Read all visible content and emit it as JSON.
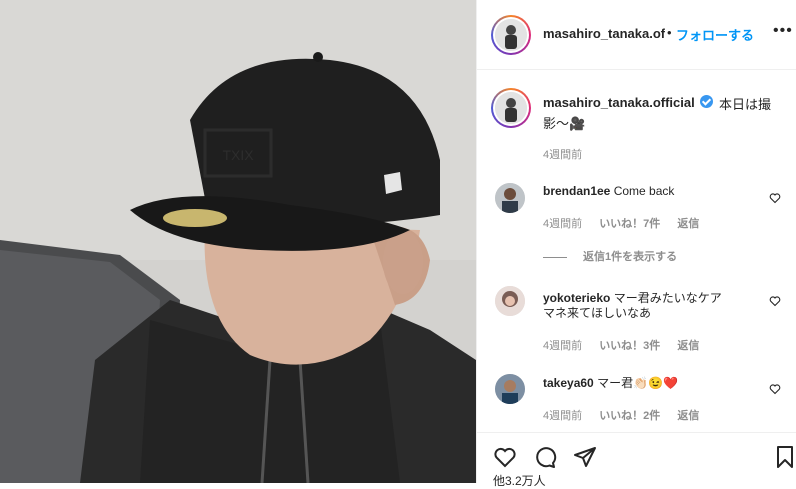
{
  "post": {
    "username": "masahiro_tanaka.official",
    "username_truncated": "masahiro_tanaka.of",
    "dot": "•",
    "follow_label": "フォローする",
    "more_label": "•••",
    "caption_text_line1": "本日は撮",
    "caption_text_line2": "影〜🎥",
    "caption_time": "4週間前"
  },
  "comments": [
    {
      "user": "brendan1ee",
      "text": "Come back",
      "time": "4週間前",
      "likes": "いいね！7件",
      "reply": "返信",
      "view_replies": "返信1件を表示する"
    },
    {
      "user": "yokoterieko",
      "text_line1": "マー君みたいなケア",
      "text_line2": "マネ来てほしいなあ",
      "time": "4週間前",
      "likes": "いいね！3件",
      "reply": "返信"
    },
    {
      "user": "takeya60",
      "text": "マー君👏🏻😉❤️",
      "time": "4週間前",
      "likes": "いいね！2件",
      "reply": "返信"
    }
  ],
  "actions": {
    "like_icon": "heart-icon",
    "comment_icon": "comment-icon",
    "share_icon": "share-icon",
    "save_icon": "bookmark-icon"
  },
  "footer": {
    "likes_partial": "他3.2万人"
  },
  "colors": {
    "follow_blue": "#0095f6",
    "verified_blue": "#3897f0",
    "muted_gray": "#8e8e8e",
    "cap_black": "#1f1f1f",
    "hoodie_black": "#2a2a2a"
  }
}
